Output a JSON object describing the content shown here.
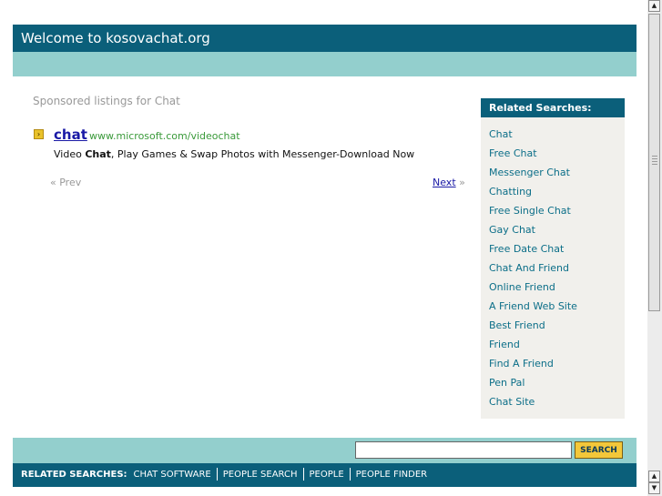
{
  "header": {
    "title": "Welcome to kosovachat.org"
  },
  "sponsored": {
    "label": "Sponsored listings for Chat",
    "ad": {
      "title": "chat",
      "url": "www.microsoft.com/videochat",
      "desc_prefix": "Video ",
      "desc_bold": "Chat",
      "desc_suffix": ", Play Games & Swap Photos with Messenger-Download Now"
    },
    "pager": {
      "prev": "« Prev",
      "next": "Next",
      "next_arrow": "»"
    }
  },
  "related": {
    "heading": "Related Searches:",
    "items": [
      "Chat",
      "Free Chat",
      "Messenger Chat",
      "Chatting",
      "Free Single Chat",
      "Gay Chat",
      "Free Date Chat",
      "Chat And Friend",
      "Online Friend",
      "A Friend Web Site",
      "Best Friend",
      "Friend",
      "Find A Friend",
      "Pen Pal",
      "Chat Site"
    ]
  },
  "footer": {
    "search_value": "",
    "search_button": "SEARCH",
    "related_label": "RELATED SEARCHES:",
    "links": [
      "CHAT SOFTWARE",
      "PEOPLE SEARCH",
      "PEOPLE",
      "PEOPLE FINDER"
    ]
  },
  "colors": {
    "brand_dark": "#0b5f7a",
    "brand_light": "#93cfcd",
    "link": "#0b6e88",
    "accent": "#f3c73a"
  }
}
